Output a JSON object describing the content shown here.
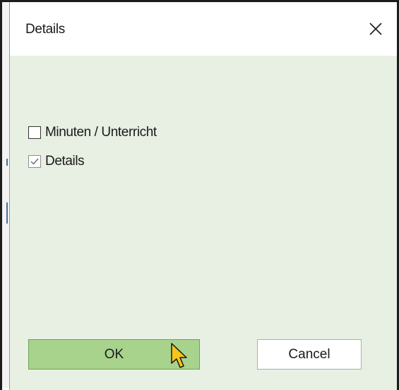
{
  "dialog": {
    "title": "Details",
    "close_icon": "close-icon",
    "options": [
      {
        "label": "Minuten / Unterricht",
        "checked": false
      },
      {
        "label": "Details",
        "checked": true
      }
    ],
    "ok_label": "OK",
    "cancel_label": "Cancel"
  },
  "colors": {
    "dialog_background": "#e8efe3",
    "ok_button": "#a8d38d",
    "cursor": "#f5c518"
  }
}
